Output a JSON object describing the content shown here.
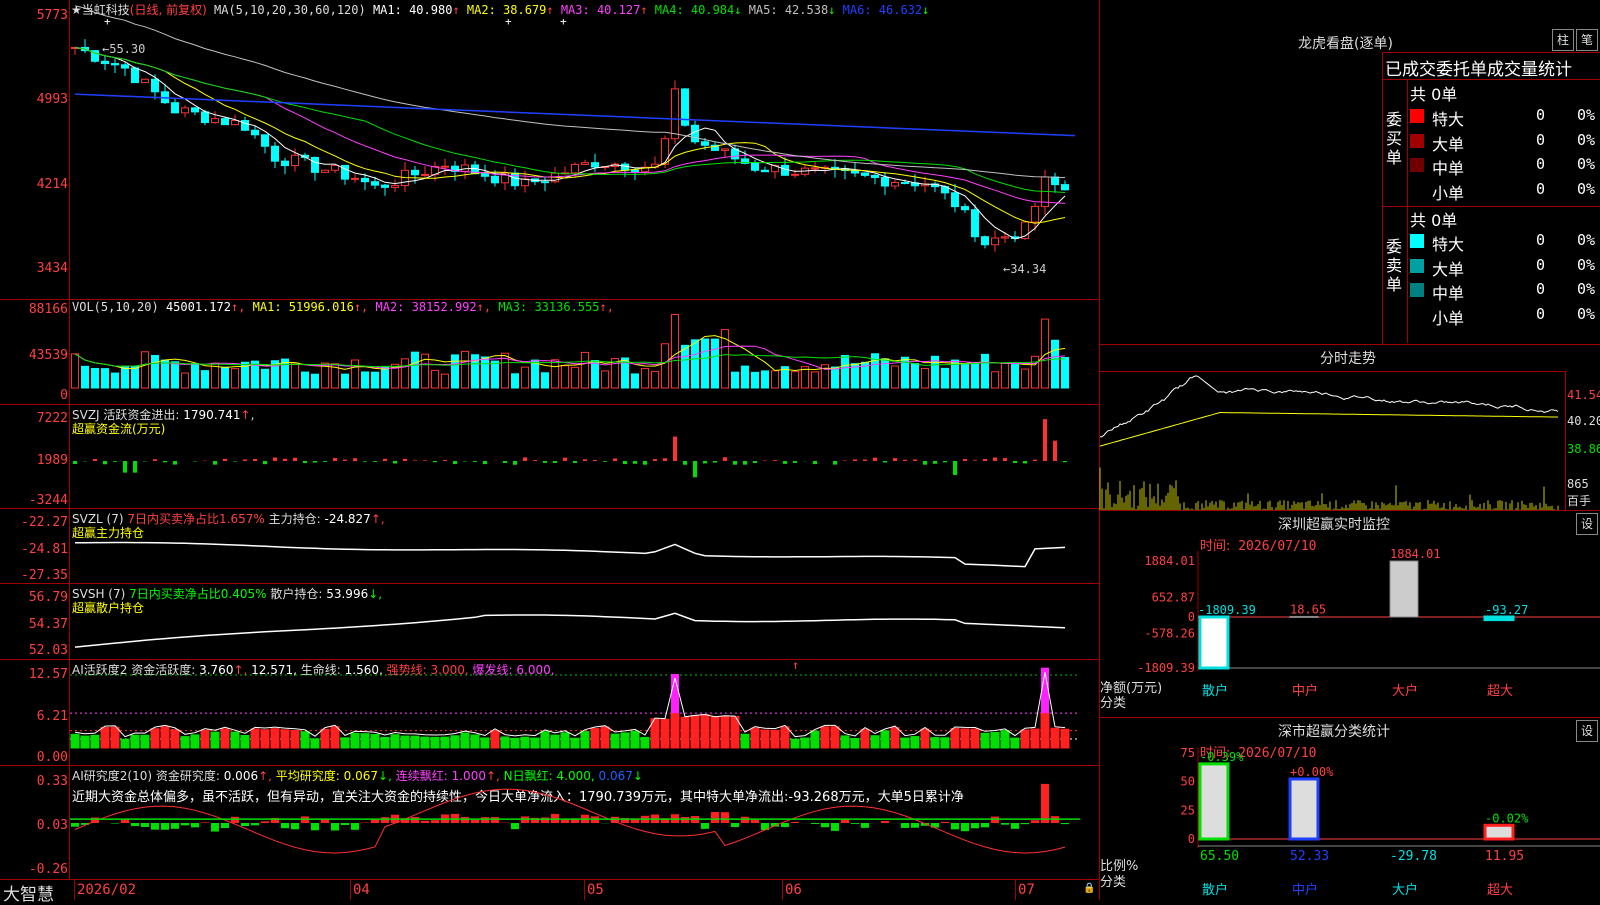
{
  "main": {
    "stock_label": "★当虹科技",
    "mode": "(日线, 前复权)",
    "ma_title": "MA(5,10,20,30,60,120)",
    "ma_values": [
      {
        "label": "MA1:",
        "value": "40.980",
        "arrow": "↑",
        "color": "#ffffff"
      },
      {
        "label": "MA2:",
        "value": "38.679",
        "arrow": "↑",
        "color": "#ffff00"
      },
      {
        "label": "MA3:",
        "value": "40.127",
        "arrow": "↑",
        "color": "#ff40ff"
      },
      {
        "label": "MA4:",
        "value": "40.984",
        "arrow": "↓",
        "color": "#00e000"
      },
      {
        "label": "MA5:",
        "value": "42.538",
        "arrow": "↓",
        "color": "#c0c0c0"
      },
      {
        "label": "MA6:",
        "value": "46.632",
        "arrow": "↓",
        "color": "#2040ff"
      }
    ],
    "y_ticks": [
      "5773",
      "4993",
      "4214",
      "3434"
    ],
    "high_label": "←55.30",
    "low_label": "←34.34"
  },
  "vol": {
    "title": "VOL(5,10,20)",
    "value": "45001.172",
    "ma": [
      {
        "label": "MA1:",
        "value": "51996.016",
        "arrow": "↑",
        "color": "#ffff00"
      },
      {
        "label": "MA2:",
        "value": "38152.992",
        "arrow": "↑",
        "color": "#ff40ff"
      },
      {
        "label": "MA3:",
        "value": "33136.555",
        "arrow": "↑",
        "color": "#00e000"
      }
    ],
    "y_ticks": [
      "88166",
      "43539",
      "0"
    ]
  },
  "svzj": {
    "title": "SVZJ  活跃资金进出:",
    "value": "1790.741",
    "arrow": "↑",
    "subtitle": "超赢资金流(万元)",
    "y_ticks": [
      "7222",
      "1989",
      "-3244"
    ]
  },
  "svzl": {
    "title": "SVZL (7)",
    "green_text": "7日内买卖净占比1.657%",
    "label2": "主力持仓:",
    "value": "-24.827",
    "arrow": "↑,",
    "subtitle": "超赢主力持仓",
    "y_ticks": [
      "-22.27",
      "-24.81",
      "-27.35"
    ]
  },
  "svsh": {
    "title": "SVSH (7)",
    "green_text": "7日内买卖净占比0.405%",
    "label2": "散户持仓:",
    "value": "53.996",
    "arrow": "↓,",
    "subtitle": "超赢散户持仓",
    "y_ticks": [
      "56.79",
      "54.37",
      "52.03"
    ]
  },
  "ai1": {
    "title": "AI活跃度2",
    "l1": "资金活跃度:",
    "v1": "3.760",
    "a1": "↑,",
    "v2": "12.571,",
    "l3": "生命线:",
    "v3": "1.560,",
    "l4": "强势线:",
    "v4": "3.000,",
    "l5": "爆发线:",
    "v5": "6.000,",
    "y_ticks": [
      "12.57",
      "6.21",
      "0.00"
    ]
  },
  "ai2": {
    "title": "AI研究度2(10)",
    "l1": "资金研究度:",
    "v1": "0.006",
    "a1": "↑,",
    "l2": "平均研究度:",
    "v2": "0.067",
    "a2": "↓,",
    "l3": "连续飘红:",
    "v3": "1.000",
    "a3": "↑,",
    "l4": "N日飘红:",
    "v4": "4.000,",
    "v5": "0.067",
    "a5": "↓",
    "comment": "近期大资金总体偏多，虽不活跃，但有异动，宜关注大资金的持续性，今日大单净流入：1790.739万元，其中特大单净流出:-93.268万元，大单5日累计净",
    "y_ticks": [
      "0.33",
      "0.03",
      "-0.26"
    ]
  },
  "xaxis": {
    "brand": "大智慧",
    "labels": [
      "2026/02",
      "04",
      "05",
      "06",
      "07"
    ]
  },
  "dragon": {
    "title": "龙虎看盘(逐单)",
    "btn1": "柱",
    "btn2": "笔",
    "header": "已成交委托单成交量统计",
    "buy_side": "委买单",
    "sell_side": "委卖单",
    "buy_total": "共 0单",
    "sell_total": "共 0单",
    "buy_rows": [
      {
        "name": "特大",
        "count": "0",
        "pct": "0%",
        "color": "#ff0000"
      },
      {
        "name": "大单",
        "count": "0",
        "pct": "0%",
        "color": "#a00000"
      },
      {
        "name": "中单",
        "count": "0",
        "pct": "0%",
        "color": "#700000"
      },
      {
        "name": "小单",
        "count": "0",
        "pct": "0%",
        "color": ""
      }
    ],
    "sell_rows": [
      {
        "name": "特大",
        "count": "0",
        "pct": "0%",
        "color": "#00ffff"
      },
      {
        "name": "大单",
        "count": "0",
        "pct": "0%",
        "color": "#00a0a0"
      },
      {
        "name": "中单",
        "count": "0",
        "pct": "0%",
        "color": "#008080"
      },
      {
        "name": "小单",
        "count": "0",
        "pct": "0%",
        "color": ""
      }
    ]
  },
  "intraday": {
    "title": "分时走势",
    "y_ticks": [
      "41.54",
      "40.20",
      "38.86"
    ],
    "vol_tick": "865",
    "vol_unit": "百手"
  },
  "sz_monitor": {
    "title": "深圳超赢实时监控",
    "btn": "设",
    "time_label": "时间:",
    "time_value": "2026/07/10",
    "y_ticks": [
      "1884.01",
      "652.87",
      "0",
      "-578.26",
      "-1809.39"
    ],
    "y_label_top": "净额(万元)",
    "y_label_bottom": "分类",
    "categories": [
      "散户",
      "中户",
      "大户",
      "超大"
    ],
    "values": [
      -1809.39,
      18.65,
      1884.01,
      -93.27
    ],
    "value_labels": [
      "-1809.39",
      "18.65",
      "1884.01",
      "-93.27"
    ]
  },
  "sz_class": {
    "title": "深市超赢分类统计",
    "btn": "设",
    "time_label": "时间:",
    "time_value": "2026/07/10",
    "y_ticks": [
      "75",
      "50",
      "25",
      "0"
    ],
    "y_label_top": "比例%",
    "y_label_bottom": "分类",
    "categories": [
      "散户",
      "中户",
      "大户",
      "超大"
    ],
    "values": [
      65.5,
      52.33,
      -29.78,
      11.95
    ],
    "change_labels": [
      "-0.39%",
      "+0.00%",
      "",
      "-0.02%"
    ],
    "value_labels": [
      "65.50",
      "52.33",
      "-29.78",
      "11.95"
    ]
  }
}
